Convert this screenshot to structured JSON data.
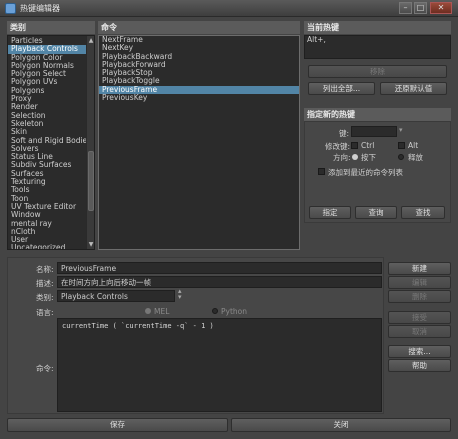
{
  "window": {
    "title": "热键编辑器"
  },
  "categories": {
    "header": "类别",
    "items": [
      "Particles",
      "Playback Controls",
      "Polygon Color",
      "Polygon Normals",
      "Polygon Select",
      "Polygon UVs",
      "Polygons",
      "Proxy",
      "Render",
      "Selection",
      "Skeleton",
      "Skin",
      "Soft and Rigid Bodies",
      "Solvers",
      "Status Line",
      "Subdiv Surfaces",
      "Surfaces",
      "Texturing",
      "Tools",
      "Toon",
      "UV Texture Editor",
      "Window",
      "mental ray",
      "nCloth",
      "User",
      "Uncategorized"
    ],
    "selected_index": 1
  },
  "commands": {
    "header": "命令",
    "items": [
      "NextFrame",
      "NextKey",
      "PlaybackBackward",
      "PlaybackForward",
      "PlaybackStop",
      "PlaybackToggle",
      "PreviousFrame",
      "PreviousKey"
    ],
    "selected_index": 6
  },
  "current_hotkey": {
    "header": "当前热键",
    "value": "Alt+,",
    "remove_label": "移除",
    "list_all_label": "列出全部...",
    "restore_label": "还原默认值"
  },
  "assign": {
    "header": "指定新的热键",
    "key_label": "键:",
    "key_value": "",
    "modifier_label": "修改键:",
    "ctrl_label": "Ctrl",
    "alt_label": "Alt",
    "direction_label": "方向:",
    "press_label": "按下",
    "release_label": "释放",
    "recent_label": "添加到最近的命令列表",
    "assign_label": "指定",
    "query_label": "查询",
    "find_label": "查找"
  },
  "details": {
    "name_label": "名称:",
    "name_value": "PreviousFrame",
    "desc_label": "描述:",
    "desc_value": "在时间方向上向后移动一帧",
    "category_label": "类别:",
    "category_value": "Playback Controls",
    "language_label": "语言:",
    "mel_label": "MEL",
    "python_label": "Python",
    "command_label": "命令:",
    "command_value": "currentTime ( `currentTime -q` - 1 )"
  },
  "side_buttons": {
    "new": "新建",
    "edit": "编辑",
    "delete": "删除",
    "accept": "接受",
    "cancel": "取消",
    "search": "搜索...",
    "help": "帮助"
  },
  "bottom": {
    "save": "保存",
    "close": "关闭"
  }
}
